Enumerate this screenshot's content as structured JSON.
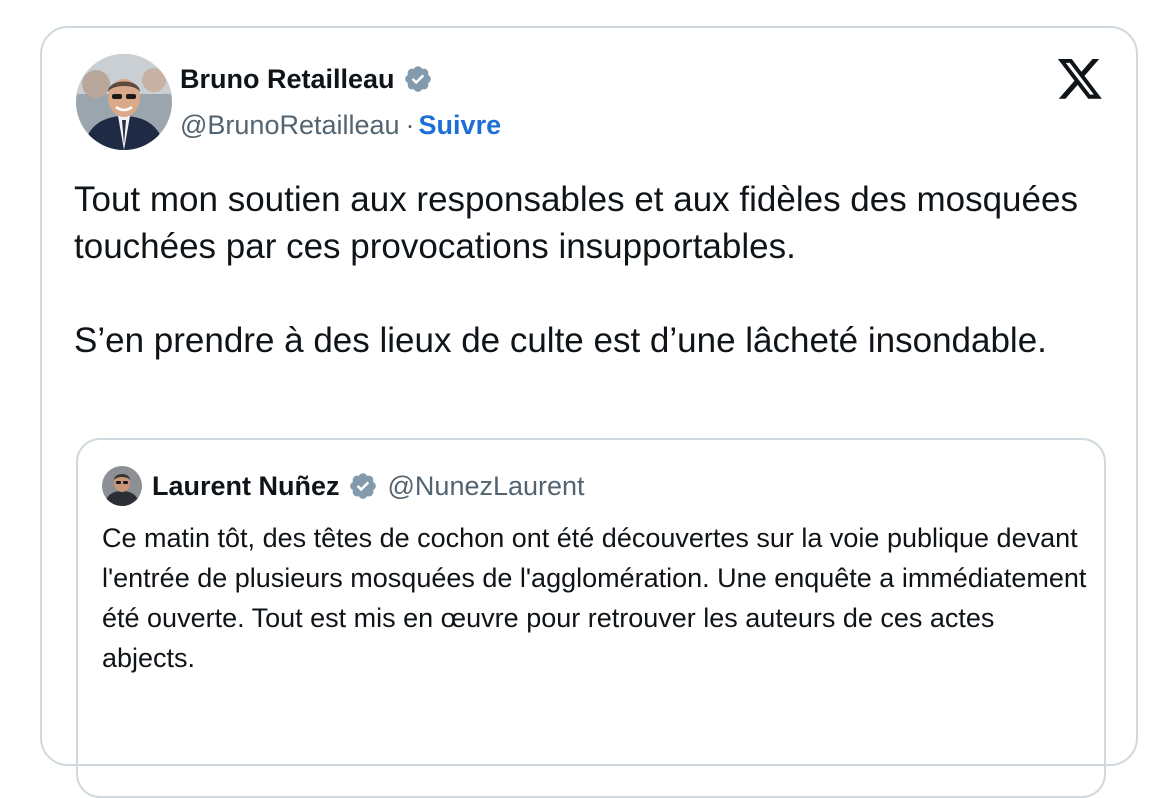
{
  "tweet": {
    "author": {
      "name": "Bruno Retailleau",
      "handle": "@BrunoRetailleau",
      "separator": "·",
      "follow_label": "Suivre",
      "verified_icon": "verified-badge-icon",
      "avatar": "avatar-photo"
    },
    "logo_icon": "x-logo-icon",
    "text": [
      "Tout mon soutien aux responsables et aux fidèles des mosquées touchées par ces provocations insupportables.",
      "S’en prendre à des lieux de culte est d’une lâcheté insondable."
    ],
    "quoted": {
      "author": {
        "name": "Laurent Nuñez",
        "handle": "@NunezLaurent",
        "verified_icon": "verified-badge-icon"
      },
      "text": "Ce matin tôt, des têtes de cochon ont été découvertes sur la voie publique devant l'entrée de plusieurs mosquées de l'agglomération. Une enquête a immédiatement été ouverte. Tout est mis en œuvre pour retrouver les auteurs de ces actes abjects."
    }
  },
  "colors": {
    "text": "#0f1419",
    "secondary": "#536471",
    "link": "#1d6fd6",
    "border": "#cfd9de",
    "verified_badge": "#829aab"
  }
}
